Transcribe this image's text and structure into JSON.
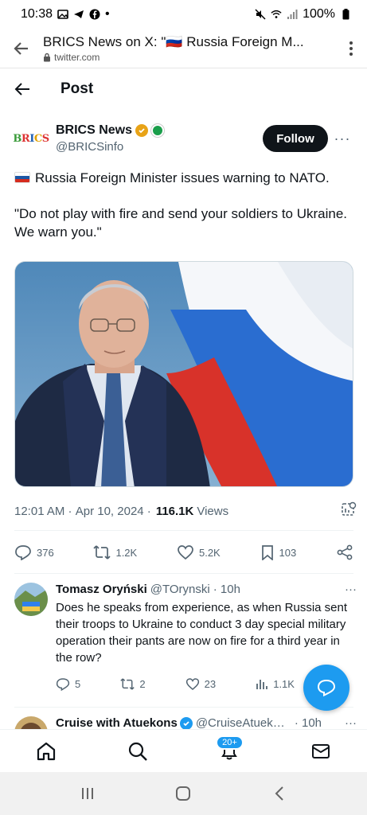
{
  "status_bar": {
    "time": "10:38",
    "battery": "100%"
  },
  "browser": {
    "title": "BRICS News on X: \"🇷🇺 Russia Foreign M...",
    "url": "twitter.com"
  },
  "page": {
    "title": "Post"
  },
  "author": {
    "name": "BRICS News",
    "handle": "@BRICSinfo",
    "avatar_text": "BRICS",
    "follow_label": "Follow"
  },
  "tweet": {
    "line1": "Russia Foreign Minister issues warning to NATO.",
    "line2": "\"Do not play with fire and send your soldiers to Ukraine. We warn you.\"",
    "time": "12:01 AM",
    "date": "Apr 10, 2024",
    "views_count": "116.1K",
    "views_label": "Views"
  },
  "actions": {
    "replies": "376",
    "reposts": "1.2K",
    "likes": "5.2K",
    "bookmarks": "103"
  },
  "replies": [
    {
      "name": "Tomasz Oryński",
      "handle": "@TOrynski",
      "time": "· 10h",
      "text": "Does he speaks from experience, as when Russia sent their troops to Ukraine to conduct 3 day special military operation their pants are now on fire for a third year in the row?",
      "replies": "5",
      "reposts": "2",
      "likes": "23",
      "views": "1.1K"
    },
    {
      "name": "Cruise with Atuekons",
      "handle": "@CruiseAtuekons",
      "time": "· 10h"
    }
  ],
  "bottom_nav": {
    "notifications_badge": "20+"
  },
  "colors": {
    "accent": "#1d9bf0",
    "text": "#0f1419",
    "muted": "#536471"
  }
}
